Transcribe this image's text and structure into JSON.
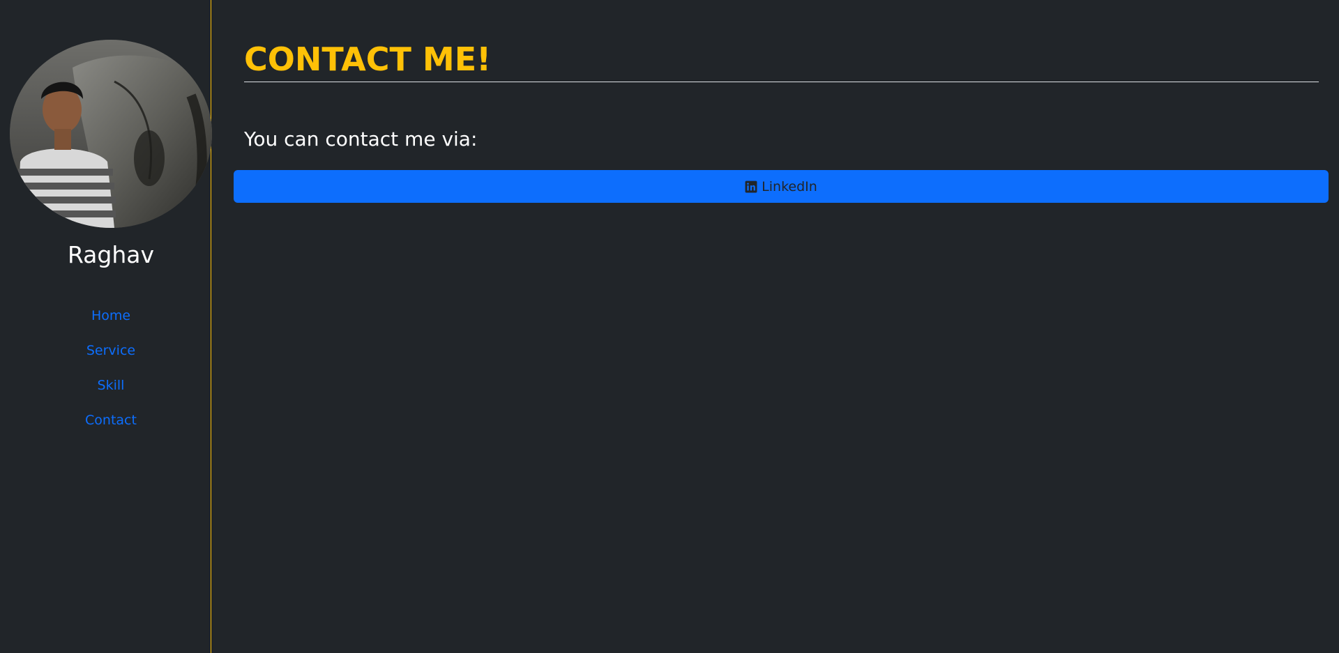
{
  "sidebar": {
    "name": "Raghav",
    "avatar_icon": "profile-photo",
    "nav": [
      {
        "label": "Home"
      },
      {
        "label": "Service"
      },
      {
        "label": "Skill"
      },
      {
        "label": "Contact"
      }
    ]
  },
  "main": {
    "title": "CONTACT ME!",
    "intro": "You can contact me via:",
    "linkedin_button": {
      "label": "LinkedIn",
      "icon": "linkedin-icon"
    }
  },
  "colors": {
    "background": "#212529",
    "accent": "#ffc107",
    "link": "#0d6efd",
    "button": "#0d6efd"
  }
}
